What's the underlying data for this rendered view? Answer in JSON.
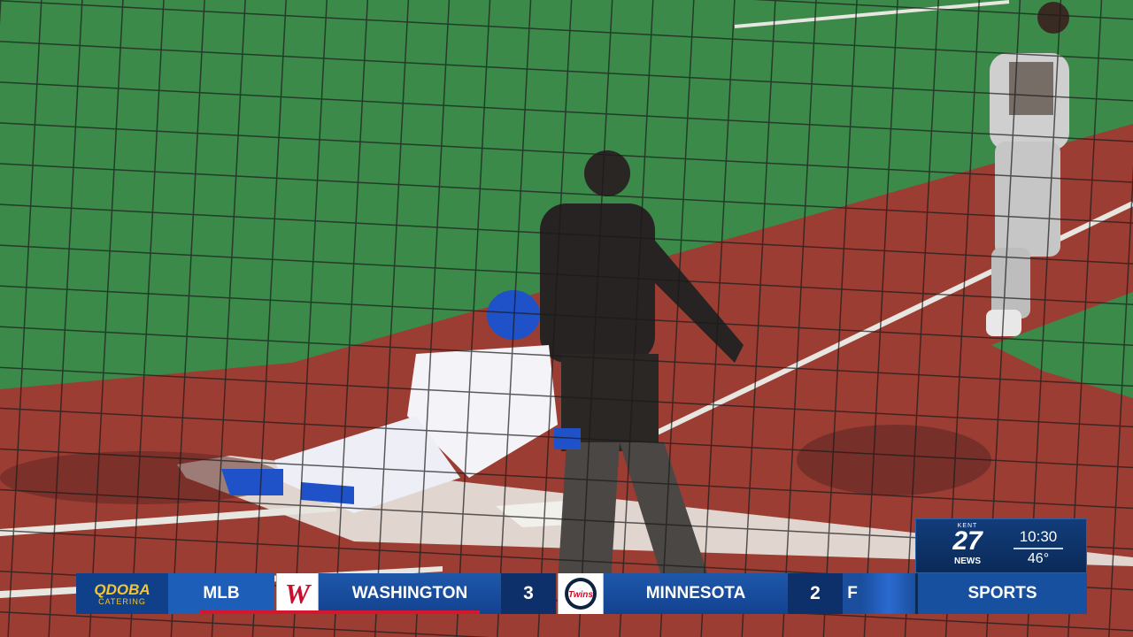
{
  "station": {
    "logo_top": "KENT",
    "logo_number": "27",
    "logo_bottom": "NEWS",
    "time": "10:30",
    "temperature": "46°"
  },
  "ticker": {
    "sponsor_line1": "QDOBA",
    "sponsor_line2": "CATERING",
    "league": "MLB",
    "away_team": "WASHINGTON",
    "away_logo_icon": "nationals-w-icon",
    "away_score": "3",
    "home_team": "MINNESOTA",
    "home_logo_icon": "twins-logo-icon",
    "home_score": "2",
    "status": "F",
    "section": "SPORTS"
  },
  "colors": {
    "ticker_blue": "#1d5fb8",
    "ticker_dark": "#0d2f6a",
    "sponsor_gold": "#f3c531",
    "nationals_red": "#d6162f"
  }
}
